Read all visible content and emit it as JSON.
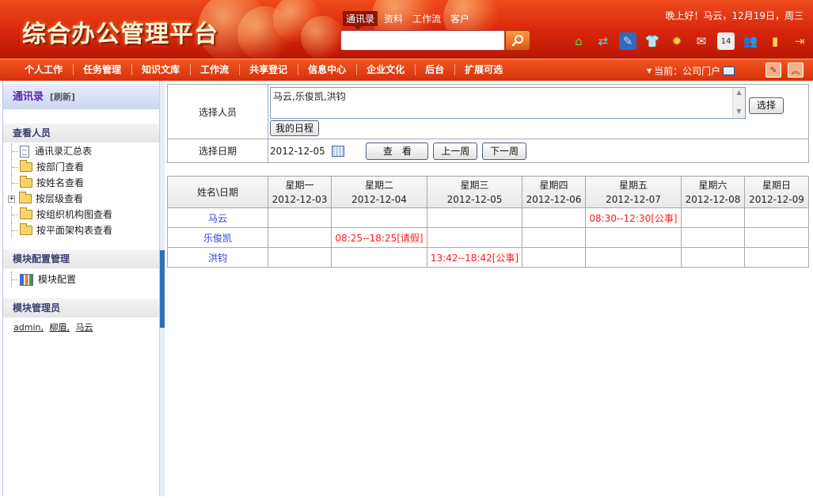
{
  "header": {
    "logo": "综合办公管理平台",
    "search_tabs": [
      "通讯录",
      "资料",
      "工作流",
      "客户"
    ],
    "search_value": "",
    "greeting": "晚上好！马云，12月19日，周三",
    "tool_icons": [
      "home-icon",
      "exchange-icon",
      "edit-icon",
      "shirt-icon",
      "gear-icon",
      "mail-icon",
      "calendar-icon",
      "users-icon",
      "note-icon",
      "logout-icon"
    ]
  },
  "nav": {
    "items": [
      "个人工作",
      "任务管理",
      "知识文库",
      "工作流",
      "共享登记",
      "信息中心",
      "企业文化",
      "后台",
      "扩展可选"
    ],
    "current": "当前：公司门户"
  },
  "sidebar": {
    "title": "通讯录",
    "refresh": "[刷新]",
    "section_view": "查看人员",
    "view_items": [
      "通讯录汇总表",
      "按部门查看",
      "按姓名查看",
      "按层级查看",
      "按组织机构图查看",
      "按平面架构表查看"
    ],
    "section_module": "模块配置管理",
    "module_item": "模块配置",
    "section_admin": "模块管理员",
    "admins": [
      "admin,",
      "柳眉,",
      "马云"
    ]
  },
  "form": {
    "select_person_label": "选择人员",
    "selected_people": "马云,乐俊凯,洪钧",
    "choose_button": "选择",
    "my_schedule_button": "我的日程",
    "select_date_label": "选择日期",
    "date_value": "2012-12-05",
    "view_button": "查　看",
    "prev_week_button": "上一周",
    "next_week_button": "下一周"
  },
  "calendar": {
    "corner": "姓名\\日期",
    "days": [
      {
        "weekday": "星期一",
        "date": "2012-12-03"
      },
      {
        "weekday": "星期二",
        "date": "2012-12-04"
      },
      {
        "weekday": "星期三",
        "date": "2012-12-05"
      },
      {
        "weekday": "星期四",
        "date": "2012-12-06"
      },
      {
        "weekday": "星期五",
        "date": "2012-12-07"
      },
      {
        "weekday": "星期六",
        "date": "2012-12-08"
      },
      {
        "weekday": "星期日",
        "date": "2012-12-09"
      }
    ],
    "rows": [
      {
        "name": "马云",
        "cells": [
          "",
          "",
          "",
          "",
          "08:30--12:30[公事]",
          "",
          ""
        ]
      },
      {
        "name": "乐俊凯",
        "cells": [
          "",
          "08:25--18:25[请假]",
          "",
          "",
          "",
          "",
          ""
        ]
      },
      {
        "name": "洪钧",
        "cells": [
          "",
          "",
          "13:42--18:42[公事]",
          "",
          "",
          "",
          ""
        ]
      }
    ]
  },
  "colors": {
    "header_red": "#d8250c",
    "event_red": "#ff1a1a",
    "name_blue": "#2b3fd6"
  }
}
